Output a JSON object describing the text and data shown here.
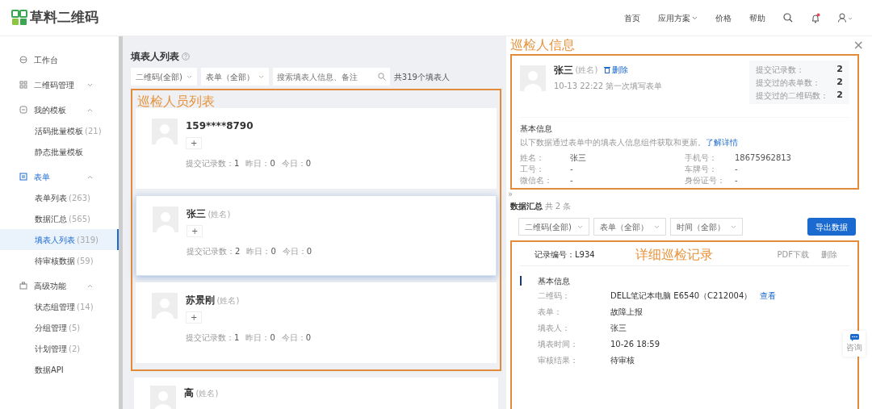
{
  "header": {
    "logo_text": "草料二维码",
    "nav": [
      {
        "label": "首页",
        "has_caret": false
      },
      {
        "label": "应用方案",
        "has_caret": true
      },
      {
        "label": "价格",
        "has_caret": false
      },
      {
        "label": "帮助",
        "has_caret": false
      }
    ],
    "notification_dot": true
  },
  "sidebar": {
    "items": [
      {
        "label": "工作台",
        "selected": false
      },
      {
        "label": "二维码管理",
        "selected": false,
        "expanded": false
      },
      {
        "label": "我的模板",
        "selected": false,
        "expanded": true,
        "children": [
          {
            "label": "活码批量模板",
            "count": "(21)",
            "selected": false
          },
          {
            "label": "静态批量模板",
            "selected": false
          }
        ]
      },
      {
        "label": "表单",
        "selected": true,
        "expanded": true,
        "children": [
          {
            "label": "表单列表",
            "count": "(263)",
            "selected": false
          },
          {
            "label": "数据汇总",
            "count": "(565)",
            "selected": false
          },
          {
            "label": "填表人列表",
            "count": "(319)",
            "selected": true
          },
          {
            "label": "待审核数据",
            "count": "(59)",
            "selected": false
          }
        ]
      },
      {
        "label": "高级功能",
        "selected": false,
        "expanded": true,
        "children": [
          {
            "label": "状态组管理",
            "count": "(14)",
            "selected": false
          },
          {
            "label": "分组管理",
            "count": "(5)",
            "selected": false
          },
          {
            "label": "计划管理",
            "count": "(2)",
            "selected": false
          },
          {
            "label": "数据API",
            "selected": false
          }
        ]
      }
    ]
  },
  "list_panel": {
    "title": "填表人列表",
    "filters": [
      "二维码(全部)",
      "表单（全部）"
    ],
    "search": {
      "placeholder": "搜索填表人信息、备注"
    },
    "total": "共319个填表人",
    "annotation": {
      "label": "巡检人员列表",
      "people": [
        {
          "name": "159****8790",
          "selected": false,
          "tag": "+",
          "stats": [
            {
              "label": "提交记录数：",
              "value": "1"
            },
            {
              "label": "昨日：",
              "value": "0"
            },
            {
              "label": "今日：",
              "value": "0"
            }
          ]
        },
        {
          "name": "张三",
          "name_hint": "(姓名)",
          "selected": true,
          "tag": "+",
          "stats": [
            {
              "label": "提交记录数：",
              "value": "2"
            },
            {
              "label": "昨日：",
              "value": "0"
            },
            {
              "label": "今日：",
              "value": "0"
            }
          ]
        },
        {
          "name": "苏景刚",
          "name_hint": "(姓名)",
          "selected": false,
          "tag": "+",
          "stats": [
            {
              "label": "提交记录数：",
              "value": "1"
            },
            {
              "label": "昨日：",
              "value": "0"
            },
            {
              "label": "今日：",
              "value": "0"
            }
          ]
        }
      ]
    },
    "more_people": [
      {
        "name": "高",
        "name_hint": "(姓名)",
        "selected": false
      }
    ]
  },
  "detail_panel": {
    "annotation": "巡检人信息",
    "close": "×",
    "profile": {
      "name": "张三",
      "name_hint": "(姓名)",
      "delete": "删除",
      "subtitle": "10-13 22:22 第一次填写表单",
      "stats": [
        {
          "label": "提交记录数：",
          "value": "2"
        },
        {
          "label": "提交过的表单数：",
          "value": "2"
        },
        {
          "label": "提交过的二维码数：",
          "value": "2"
        }
      ]
    },
    "basic_info": {
      "title": "基本信息",
      "description": "以下数据通过表单中的填表人信息组件获取和更新。",
      "link": "了解详情",
      "fields": [
        {
          "label": "姓名：",
          "value": "张三"
        },
        {
          "label": "手机号：",
          "value": "18675962813"
        },
        {
          "label": "工号：",
          "value": "-"
        },
        {
          "label": "车牌号：",
          "value": "-"
        },
        {
          "label": "微信名：",
          "value": "-"
        },
        {
          "label": "身份证号：",
          "value": "-"
        }
      ]
    },
    "collapse": "»",
    "summary": {
      "title": "数据汇总",
      "count": "共 2 条",
      "filters": [
        "二维码(全部)",
        "表单（全部）",
        "时间（全部）"
      ],
      "export_button": "导出数据"
    },
    "record": {
      "annotation": "详细巡检记录",
      "number": "记录编号：L934",
      "actions": [
        "PDF下载",
        "删除"
      ],
      "section": "基本信息",
      "rows": [
        {
          "label": "二维码：",
          "value": "DELL笔记本电脑 E6540（C212004）",
          "link": "查看"
        },
        {
          "label": "表单：",
          "value": "故障上报"
        },
        {
          "label": "填表人：",
          "value": "张三"
        },
        {
          "label": "填表时间：",
          "value": "10-26 18:59"
        },
        {
          "label": "审核结果：",
          "value": "待审核"
        }
      ]
    },
    "consult": "咨询"
  }
}
